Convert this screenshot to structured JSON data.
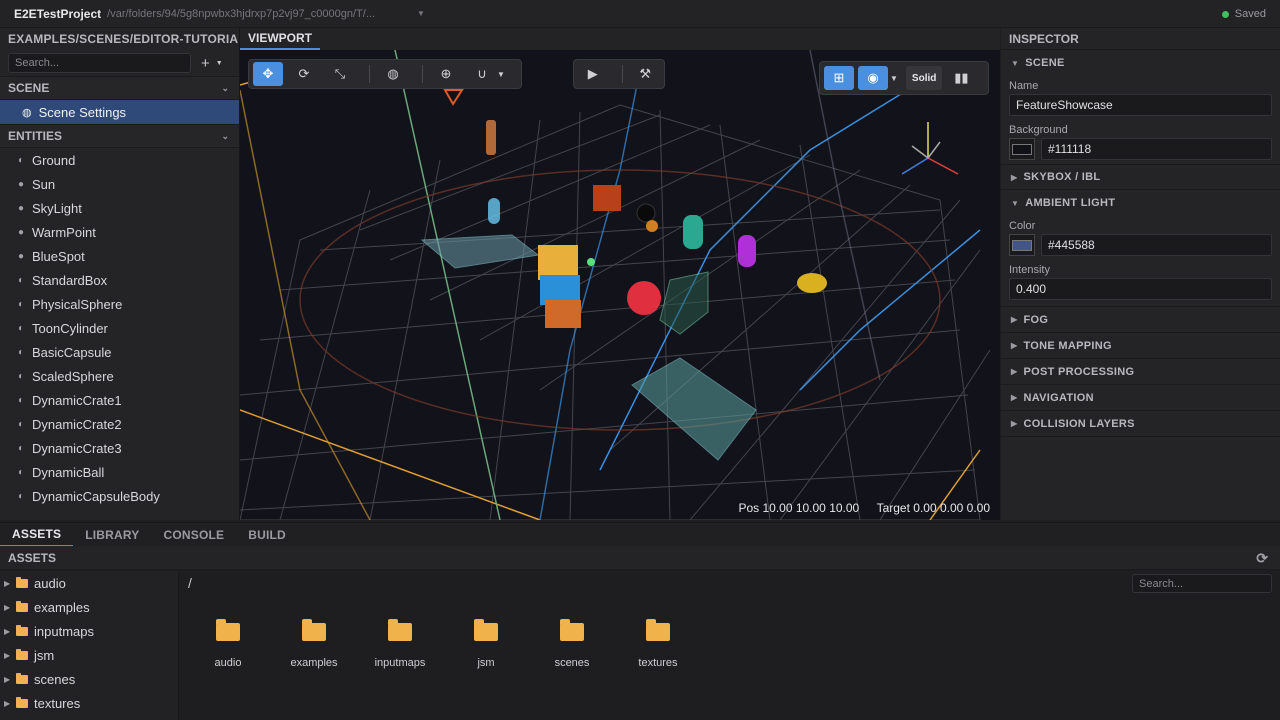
{
  "titlebar": {
    "project": "E2ETestProject",
    "path": "/var/folders/94/5g8npwbx3hjdrxp7p2vj97_c0000gn/T/...",
    "status": "Saved"
  },
  "left": {
    "tab": "EXAMPLES/SCENES/EDITOR-TUTORIAL.VS",
    "search_placeholder": "Search...",
    "scene_header": "SCENE",
    "scene_item": "Scene Settings",
    "entities_header": "ENTITIES",
    "entities": [
      "Ground",
      "Sun",
      "SkyLight",
      "WarmPoint",
      "BlueSpot",
      "StandardBox",
      "PhysicalSphere",
      "ToonCylinder",
      "BasicCapsule",
      "ScaledSphere",
      "DynamicCrate1",
      "DynamicCrate2",
      "DynamicCrate3",
      "DynamicBall",
      "DynamicCapsuleBody"
    ]
  },
  "viewport": {
    "tab": "VIEWPORT",
    "shading": "Solid",
    "pos": "Pos 10.00 10.00 10.00",
    "target": "Target 0.00 0.00 0.00"
  },
  "inspector": {
    "title": "INSPECTOR",
    "scene_section": "SCENE",
    "name_label": "Name",
    "name_value": "FeatureShowcase",
    "bg_label": "Background",
    "bg_value": "#111118",
    "skybox": "SKYBOX / IBL",
    "ambient": "AMBIENT LIGHT",
    "color_label": "Color",
    "color_value": "#445588",
    "intensity_label": "Intensity",
    "intensity_value": "0.400",
    "sections": [
      "FOG",
      "TONE MAPPING",
      "POST PROCESSING",
      "NAVIGATION",
      "COLLISION LAYERS"
    ]
  },
  "bottom": {
    "tabs": [
      "ASSETS",
      "LIBRARY",
      "CONSOLE",
      "BUILD"
    ],
    "assets_header": "ASSETS",
    "folders": [
      "audio",
      "examples",
      "inputmaps",
      "jsm",
      "scenes",
      "textures"
    ],
    "crumb": "/",
    "search_placeholder": "Search..."
  },
  "colors": {
    "accent": "#4a8fe0",
    "selected": "#2f4a78",
    "folder": "#f0b24a",
    "saved": "#3fbf5f"
  }
}
